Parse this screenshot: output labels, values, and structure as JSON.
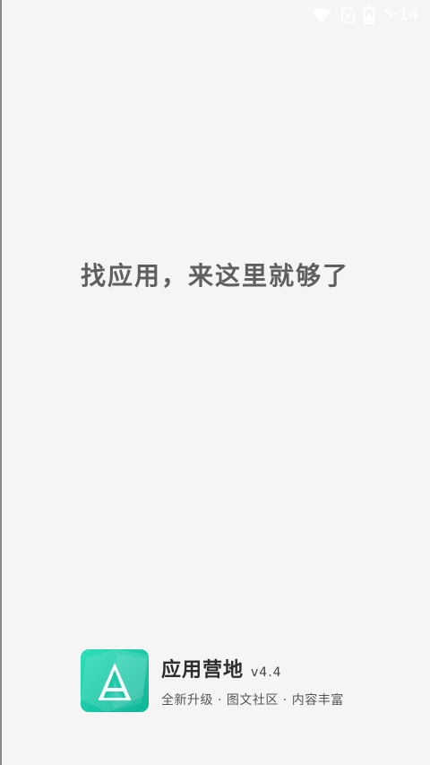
{
  "status_bar": {
    "time": "5:14",
    "icons": [
      "wifi-icon",
      "no-sim-icon",
      "battery-icon"
    ]
  },
  "splash": {
    "slogan": "找应用，来这里就够了"
  },
  "brand": {
    "logo_icon": "app-logo-icon",
    "name": "应用营地",
    "version": "v4.4",
    "tagline": "全新升级 · 图文社区 · 内容丰富",
    "accent_color": "#1fd0ac"
  }
}
